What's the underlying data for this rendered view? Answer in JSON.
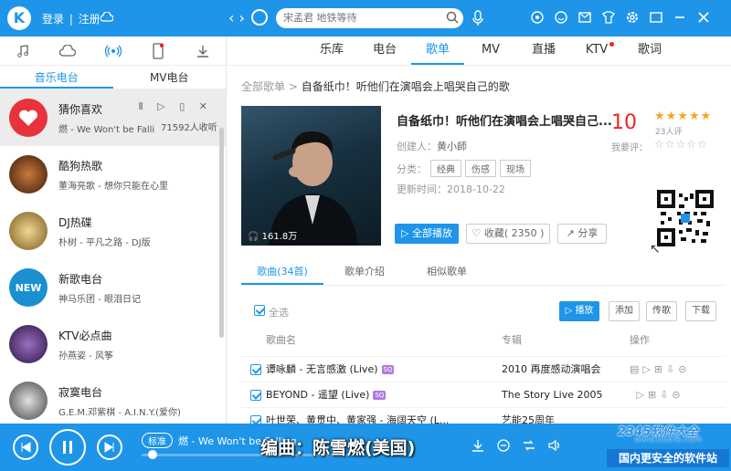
{
  "app": {
    "logo_letter": "K",
    "login": "登录",
    "register": "注册",
    "search_placeholder": "宋孟君 地铁等待"
  },
  "sidebar": {
    "tabs": [
      "音乐电台",
      "MV电台"
    ],
    "items": [
      {
        "title": "猜你喜欢",
        "sub": "燃 - We Won't be Falli",
        "count": "71592人收听",
        "color": "#e8323c",
        "selected": true
      },
      {
        "title": "酷狗热歌",
        "sub": "董海亮歌 - 想你只能在心里",
        "color": "#7a2d1a"
      },
      {
        "title": "DJ热碟",
        "sub": "朴树 - 平凡之路 - DJ版",
        "color": "#c6a04a"
      },
      {
        "title": "新歌电台",
        "sub": "神马乐团 - 眼泪日记",
        "color": "#1a8fd1"
      },
      {
        "title": "KTV必点曲",
        "sub": "孙燕姿 - 风筝",
        "color": "#4a2d6e"
      },
      {
        "title": "寂寞电台",
        "sub": "G.E.M.邓紫棋 - A.I.N.Y.(爱你)",
        "color": "#7c7c7c"
      }
    ]
  },
  "main": {
    "tabs": [
      "乐库",
      "电台",
      "歌单",
      "MV",
      "直播",
      "KTV",
      "歌词"
    ],
    "breadcrumb_root": "全部歌单",
    "breadcrumb_current": "自备纸巾！听他们在演唱会上唱哭自己的歌",
    "playlist": {
      "title": "自备纸巾！听他们在演唱会上唱哭自己...",
      "score": "10",
      "rating_count": "23人评",
      "my_rating_label": "我要评：",
      "creator_label": "创建人：",
      "creator": "黄小師",
      "category_label": "分类：",
      "tags": [
        "经典",
        "伤感",
        "现场"
      ],
      "updated_label": "更新时间：",
      "updated": "2018-10-22",
      "listen_count": "161.8万",
      "play_all": "全部播放",
      "favorite": "收藏( 2350 )",
      "share": "分享"
    },
    "subtabs": [
      "歌曲(34首)",
      "歌单介绍",
      "相似歌单"
    ],
    "toolbar": {
      "select_all": "全选",
      "play": "播放",
      "add": "添加",
      "send": "传歌",
      "download": "下载"
    },
    "table_headers": {
      "song": "歌曲名",
      "album": "专辑",
      "ops": "操作"
    },
    "songs": [
      {
        "name": "谭咏麟 - 无言感激 (Live)",
        "album": "2010 再度感动演唱会"
      },
      {
        "name": "BEYOND - 遥望 (Live)",
        "album": "The Story Live 2005"
      },
      {
        "name": "叶世荣、黄贯中、黄家强 - 海阔天空 (L...",
        "album": "艺能25周年"
      }
    ]
  },
  "player": {
    "quality": "标准",
    "track": "燃 - We Won't be Falling",
    "lyric": "编曲：陈雪燃(美国)"
  },
  "watermark": {
    "line1": "2345软件大全",
    "line2": "www.DuoTe.com",
    "line3": "国内更安全的软件站"
  }
}
